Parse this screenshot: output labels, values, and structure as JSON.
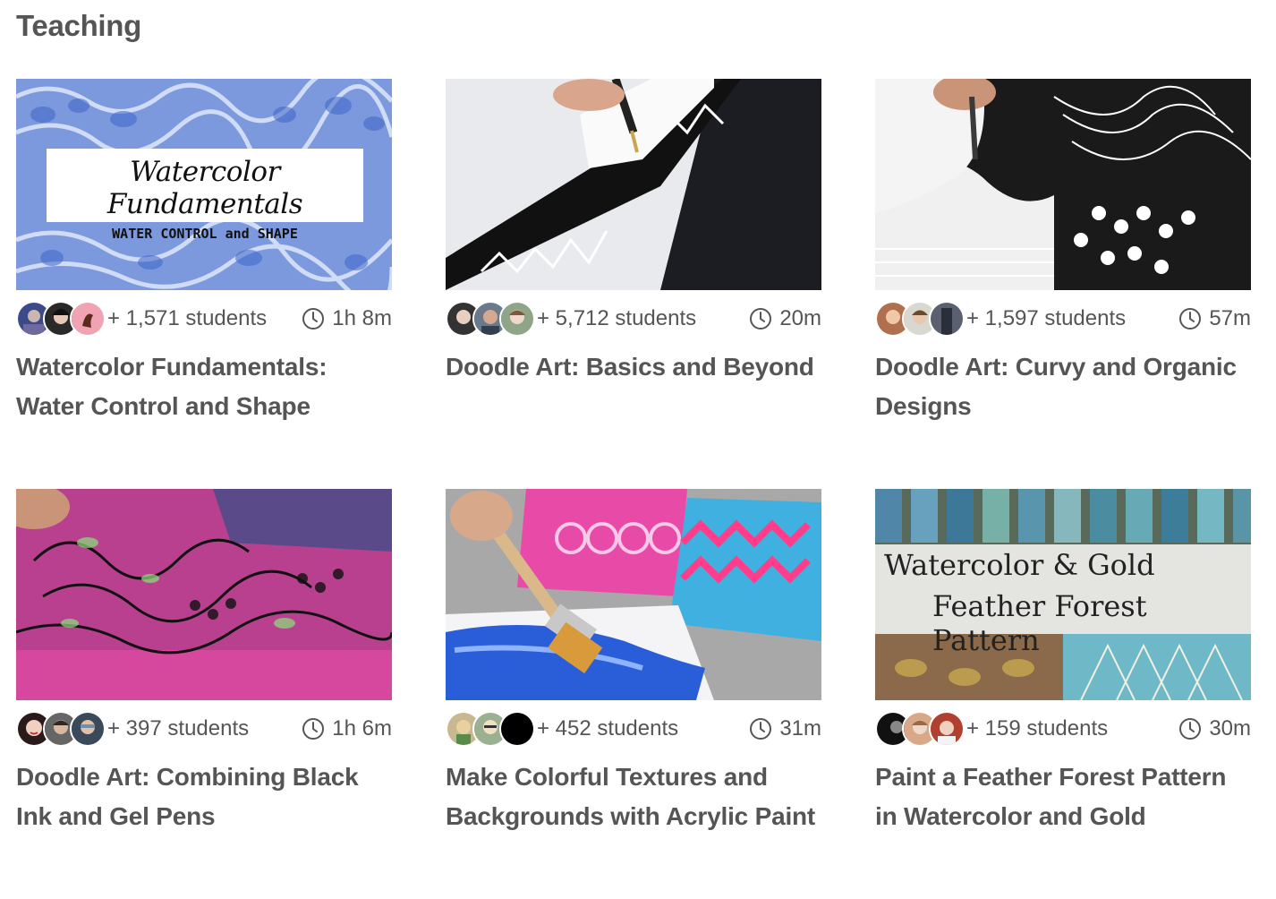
{
  "section": {
    "title": "Teaching"
  },
  "courses": [
    {
      "title": "Watercolor Fundamentals: Water Control and Shape",
      "students": "+ 1,571 students",
      "duration": "1h 8m",
      "thumb_text": {
        "line1": "Watercolor Fundamentals",
        "line2": "WATER CONTROL and SHAPE"
      }
    },
    {
      "title": "Doodle Art: Basics and Beyond",
      "students": "+ 5,712 students",
      "duration": "20m"
    },
    {
      "title": "Doodle Art: Curvy and Organic Designs",
      "students": "+ 1,597 students",
      "duration": "57m"
    },
    {
      "title": "Doodle Art: Combining Black Ink and Gel Pens",
      "students": "+ 397 students",
      "duration": "1h 6m"
    },
    {
      "title": "Make Colorful Textures and Backgrounds with Acrylic Paint",
      "students": "+ 452 students",
      "duration": "31m"
    },
    {
      "title": "Paint a Feather Forest Pattern in Watercolor and Gold",
      "students": "+ 159 students",
      "duration": "30m",
      "thumb_text": {
        "line1": "Watercolor & Gold",
        "line2": "Feather Forest Pattern"
      }
    }
  ],
  "icons": {
    "duration": "clock-icon"
  },
  "colors": {
    "text": "#555555",
    "background": "#ffffff"
  }
}
